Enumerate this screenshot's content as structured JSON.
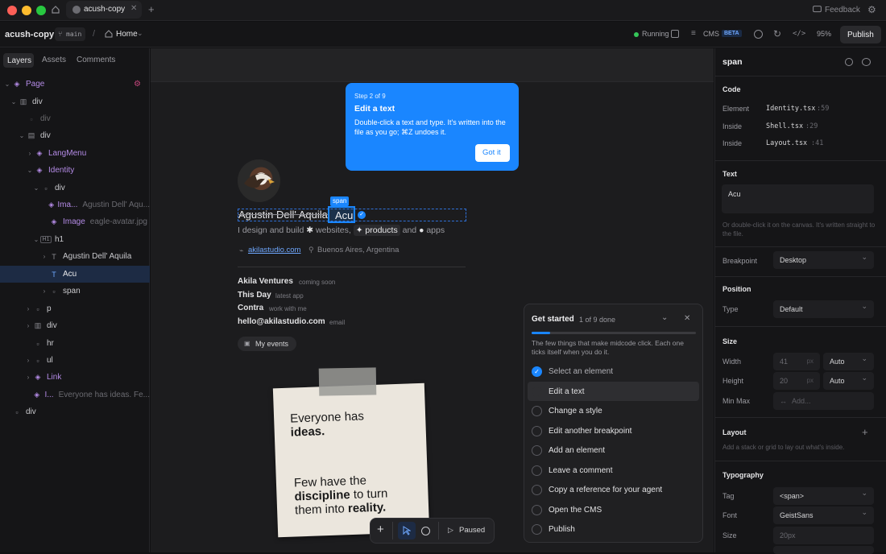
{
  "titlebar": {
    "tab_title": "acush-copy",
    "feedback": "Feedback"
  },
  "topbar": {
    "project": "acush-copy",
    "branch": "main",
    "page": "Home",
    "status": "Running",
    "cms": "CMS",
    "cms_badge": "BETA",
    "zoom": "95%",
    "publish": "Publish"
  },
  "left": {
    "tabs": [
      "Layers",
      "Assets",
      "Comments"
    ],
    "tree": [
      {
        "label": "Page",
        "sub": ""
      },
      {
        "label": "div",
        "sub": ""
      },
      {
        "label": "div",
        "sub": ""
      },
      {
        "label": "div",
        "sub": ""
      },
      {
        "label": "LangMenu",
        "sub": ""
      },
      {
        "label": "Identity",
        "sub": ""
      },
      {
        "label": "div",
        "sub": ""
      },
      {
        "label": "Ima...",
        "sub": "Agustin Dell' Aqu..."
      },
      {
        "label": "Image",
        "sub": "eagle-avatar.jpg"
      },
      {
        "label": "h1",
        "sub": "H1"
      },
      {
        "label": "Agustin Dell' Aquila",
        "sub": ""
      },
      {
        "label": "Acu",
        "sub": ""
      },
      {
        "label": "span",
        "sub": ""
      },
      {
        "label": "p",
        "sub": ""
      },
      {
        "label": "div",
        "sub": ""
      },
      {
        "label": "hr",
        "sub": ""
      },
      {
        "label": "ul",
        "sub": ""
      },
      {
        "label": "Link",
        "sub": ""
      },
      {
        "label": "I...",
        "sub": "Everyone has ideas. Fe..."
      },
      {
        "label": "div",
        "sub": ""
      }
    ]
  },
  "canvas": {
    "span_tag": "span",
    "name_main": "Agustin Dell' Aquila",
    "name_nick": "Acu",
    "bio_1": "I design and build",
    "bio_websites": "websites,",
    "bio_products": "products",
    "bio_and": "and",
    "bio_apps": "apps",
    "site": "akilastudio.com",
    "location": "Buenos Aires, Argentina",
    "links": [
      {
        "name": "Akila Ventures",
        "note": "coming soon"
      },
      {
        "name": "This Day",
        "note": "latest app"
      },
      {
        "name": "Contra",
        "note": "work with me"
      },
      {
        "name": "hello@akilastudio.com",
        "note": "email"
      }
    ],
    "events": "My events",
    "note_l1": "Everyone has",
    "note_l2": "ideas.",
    "note_l3": "Few have the",
    "note_l4a": "discipline",
    "note_l4b": "to turn",
    "note_l5a": "them into",
    "note_l5b": "reality."
  },
  "tip": {
    "step": "Step 2 of 9",
    "title": "Edit a text",
    "body": "Double-click a text and type. It's written into the file as you go; ⌘Z undoes it.",
    "button": "Got it"
  },
  "get_started": {
    "title": "Get started",
    "progress_text": "1 of 9 done",
    "progress": 0.111,
    "desc": "The few things that make midcode click. Each one ticks itself when you do it.",
    "items": [
      "Select an element",
      "Edit a text",
      "Change a style",
      "Edit another breakpoint",
      "Add an element",
      "Leave a comment",
      "Copy a reference for your agent",
      "Open the CMS",
      "Publish"
    ]
  },
  "toolbar": {
    "paused": "Paused"
  },
  "right": {
    "title": "span",
    "code": "Code",
    "element_lbl": "Element",
    "element_file": "Identity.tsx",
    "element_line": ":59",
    "inside1_lbl": "Inside",
    "inside1_file": "Shell.tsx",
    "inside1_line": ":29",
    "inside2_lbl": "Inside",
    "inside2_file": "Layout.tsx",
    "inside2_line": ":41",
    "text": "Text",
    "text_value": "Acu",
    "text_hint": "Or double-click it on the canvas. It's written straight to the file.",
    "breakpoint": "Breakpoint",
    "breakpoint_value": "Desktop",
    "position": "Position",
    "type_lbl": "Type",
    "type_value": "Default",
    "size": "Size",
    "width_lbl": "Width",
    "width_value": "41",
    "width_unit": "px",
    "width_mode": "Auto",
    "height_lbl": "Height",
    "height_value": "20",
    "height_unit": "px",
    "height_mode": "Auto",
    "minmax_lbl": "Min Max",
    "minmax_add": "Add...",
    "layout": "Layout",
    "layout_hint": "Add a stack or grid to lay out what's inside.",
    "typography": "Typography",
    "tag_lbl": "Tag",
    "tag_value": "<span>",
    "font_lbl": "Font",
    "font_value": "GeistSans",
    "size_lbl": "Size",
    "size_value": "20px"
  }
}
